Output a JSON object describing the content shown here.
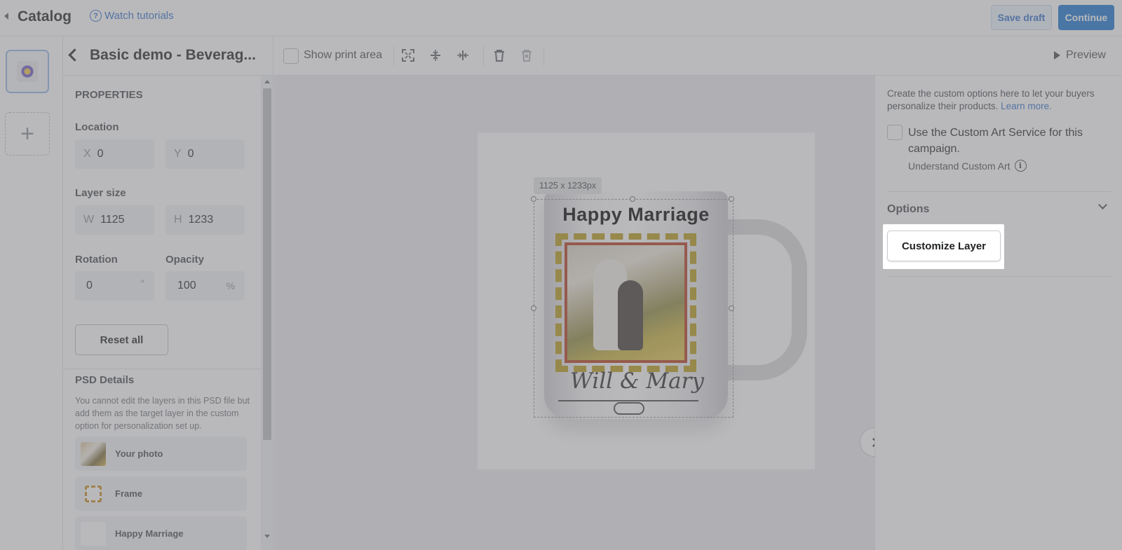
{
  "topbar": {
    "back_label": "Catalog",
    "tutorials_label": "Watch tutorials",
    "save_draft_label": "Save draft",
    "continue_label": "Continue"
  },
  "rail": {
    "add_icon": "plus-icon"
  },
  "panel": {
    "product_title": "Basic demo - Beverag...",
    "properties_title": "PROPERTIES",
    "location_label": "Location",
    "x_prefix": "X",
    "x_value": "0",
    "y_prefix": "Y",
    "y_value": "0",
    "layer_size_label": "Layer size",
    "w_prefix": "W",
    "w_value": "1125",
    "h_prefix": "H",
    "h_value": "1233",
    "rotation_label": "Rotation",
    "rotation_value": "0",
    "rotation_unit": "°",
    "opacity_label": "Opacity",
    "opacity_value": "100",
    "opacity_unit": "%",
    "reset_label": "Reset all",
    "psd_title": "PSD Details",
    "psd_desc": "You cannot edit the layers in this PSD file but add them as the target layer in the custom option for personalization set up.",
    "layers": [
      {
        "label": "Your photo"
      },
      {
        "label": "Frame"
      },
      {
        "label": "Happy Marriage"
      }
    ]
  },
  "toolbar": {
    "show_print_area_label": "Show print area",
    "preview_label": "Preview"
  },
  "canvas": {
    "dimension_tag": "1125 x 1233px",
    "mug_title": "Happy Marriage",
    "mug_names": "Will & Mary"
  },
  "right_panel": {
    "description": "Create the custom options here to let your buyers personalize their products.",
    "learn_more": "Learn more.",
    "custom_art_label": "Use the Custom Art Service for this campaign.",
    "understand_label": "Understand Custom Art",
    "options_title": "Options",
    "customize_label": "Customize Layer"
  },
  "colors": {
    "accent": "#1874d2",
    "link": "#2c6ecb"
  }
}
